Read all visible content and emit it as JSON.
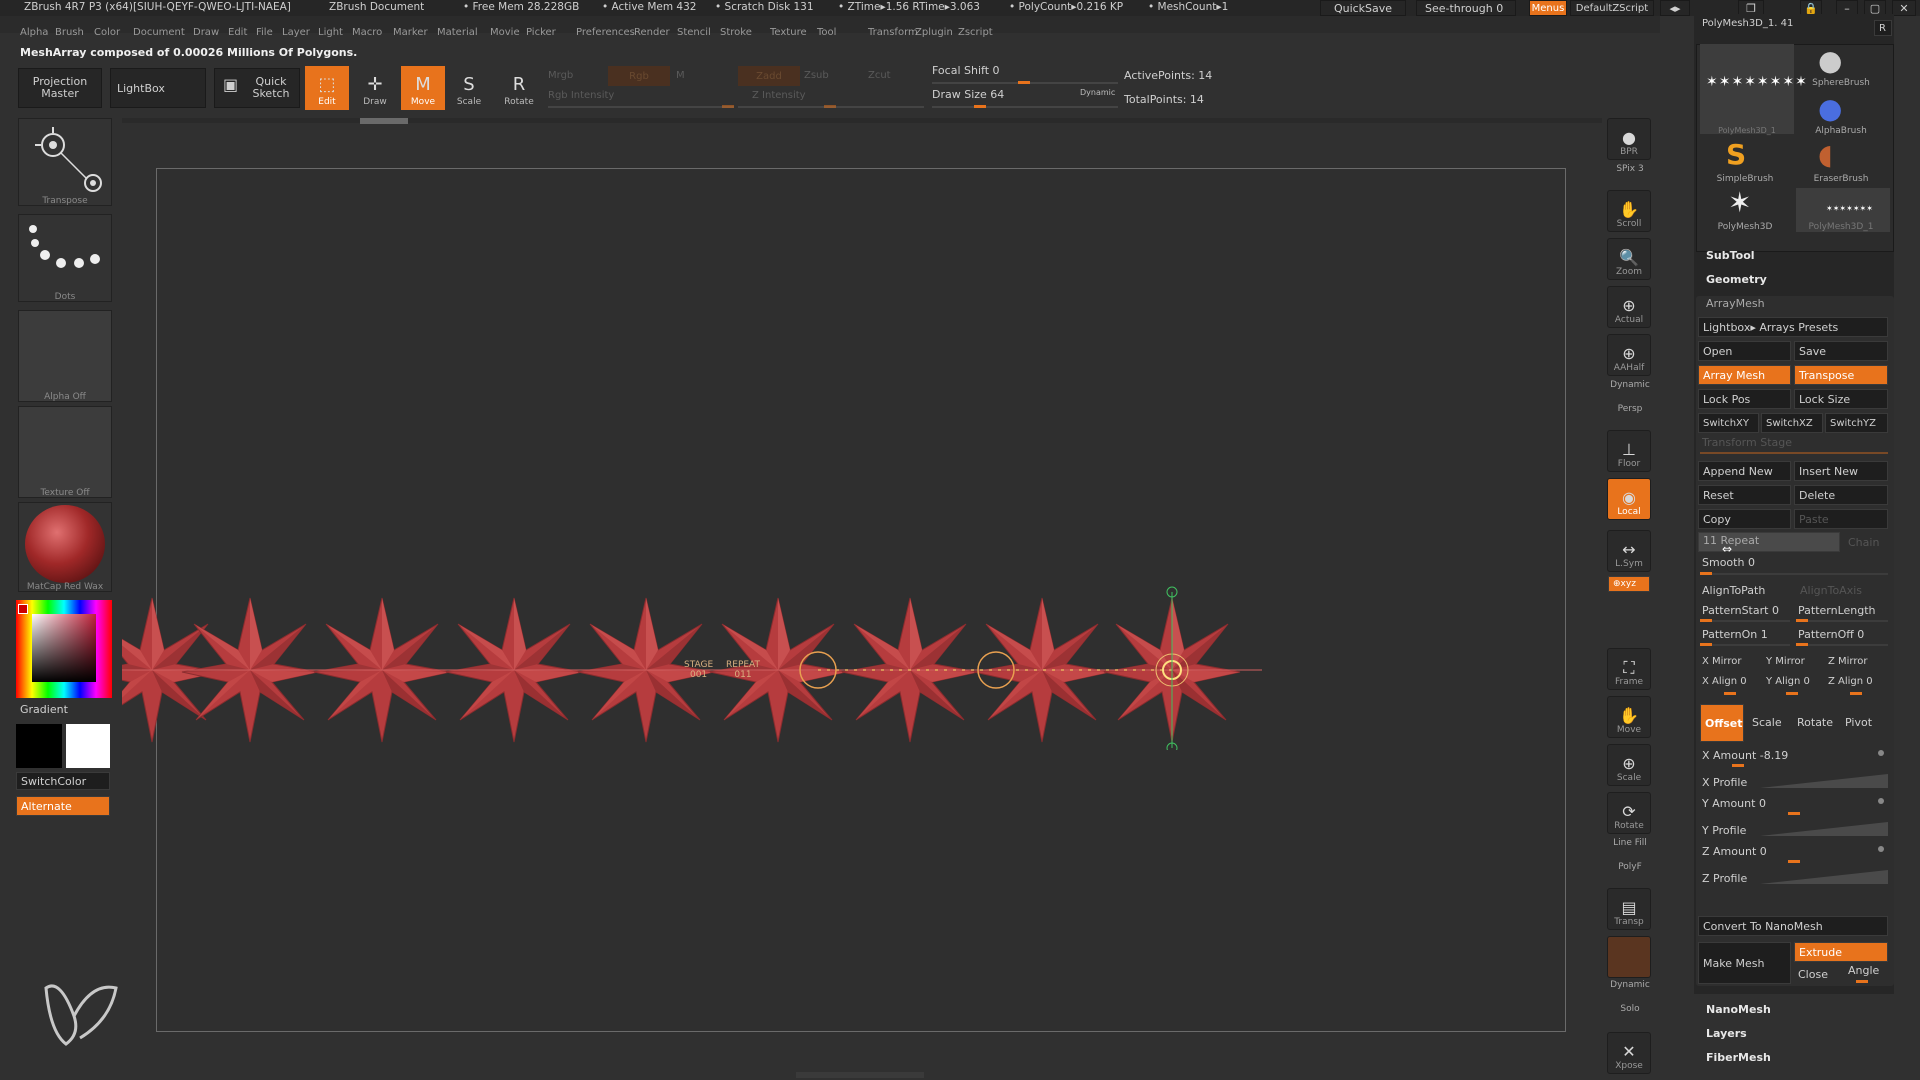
{
  "title_bar": {
    "app": "ZBrush 4R7 P3 (x64)[SIUH-QEYF-QWEO-LJTI-NAEA]",
    "document": "ZBrush Document",
    "free_mem": "• Free Mem 28.228GB",
    "active_mem": "• Active Mem 432",
    "scratch": "• Scratch Disk 131",
    "ztime": "• ZTime▸1.56 RTime▸3.063",
    "polycount": "• PolyCount▸0.216 KP",
    "meshcount": "• MeshCount▸1",
    "quicksave": "QuickSave",
    "seethrough": "See-through  0",
    "menus": "Menus",
    "script": "DefaultZScript"
  },
  "menu": [
    "Alpha",
    "Brush",
    "Color",
    "Document",
    "Draw",
    "Edit",
    "File",
    "Layer",
    "Light",
    "Macro",
    "Marker",
    "Material",
    "Movie",
    "Picker",
    "Preferences",
    "Render",
    "Stencil",
    "Stroke",
    "Texture",
    "Tool",
    "Transform",
    "Zplugin",
    "Zscript"
  ],
  "notification": "MeshArray composed of 0.00026 Millions Of Polygons.",
  "top_toolbar": {
    "projection_master": "Projection Master",
    "lightbox": "LightBox",
    "quick_sketch": "Quick Sketch",
    "edit": "Edit",
    "draw": "Draw",
    "move": "Move",
    "scale": "Scale",
    "rotate": "Rotate",
    "mrgb": "Mrgb",
    "rgb": "Rgb",
    "m": "M",
    "rgb_intensity": "Rgb Intensity",
    "zadd": "Zadd",
    "zsub": "Zsub",
    "zcut": "Zcut",
    "z_intensity": "Z Intensity",
    "focal_shift": "Focal Shift 0",
    "draw_size": "Draw Size 64",
    "dynamic": "Dynamic",
    "active_points": "ActivePoints: 14",
    "total_points": "TotalPoints: 14"
  },
  "left_shelf": {
    "transpose": "Transpose",
    "dots": "Dots",
    "alpha": "Alpha Off",
    "texture": "Texture Off",
    "material": "MatCap Red Wax",
    "gradient": "Gradient",
    "switch_color": "SwitchColor",
    "alternate": "Alternate"
  },
  "canvas_labels": {
    "stage": "STAGE",
    "stage_val": "001",
    "repeat": "REPEAT",
    "repeat_val": "011"
  },
  "right_dock": [
    {
      "label": "BPR"
    },
    {
      "label": "SPix 3"
    },
    {
      "label": "Scroll"
    },
    {
      "label": "Zoom"
    },
    {
      "label": "Actual"
    },
    {
      "label": "AAHalf"
    },
    {
      "label": "Dynamic"
    },
    {
      "label": "Persp"
    },
    {
      "label": "Floor"
    },
    {
      "label": "Local"
    },
    {
      "label": "L.Sym"
    },
    {
      "label": "Frame"
    },
    {
      "label": "Move"
    },
    {
      "label": "Scale"
    },
    {
      "label": "Rotate"
    },
    {
      "label": "Line Fill"
    },
    {
      "label": "PolyF"
    },
    {
      "label": "Transp"
    },
    {
      "label": "Dynamic"
    },
    {
      "label": "Solo"
    },
    {
      "label": "Xpose"
    }
  ],
  "tool_panel": {
    "current_tool": "PolyMesh3D_1. 41",
    "r": "R",
    "brushes": [
      "SphereBrush",
      "AlphaBrush",
      "SimpleBrush",
      "EraserBrush",
      "PolyMesh3D",
      "PolyMesh3D_1"
    ],
    "thumb_label": "PolyMesh3D_1",
    "subtool": "SubTool",
    "geometry": "Geometry",
    "arraymesh": "ArrayMesh",
    "lightbox_presets": "Lightbox▸ Arrays Presets",
    "open": "Open",
    "save": "Save",
    "array_mesh": "Array Mesh",
    "transpose": "Transpose",
    "lock_pos": "Lock Pos",
    "lock_size": "Lock Size",
    "switch_xy": "SwitchXY",
    "switch_xz": "SwitchXZ",
    "switch_yz": "SwitchYZ",
    "transform_stage": "Transform Stage",
    "append_new": "Append New",
    "insert_new": "Insert New",
    "reset": "Reset",
    "delete": "Delete",
    "copy": "Copy",
    "paste": "Paste",
    "repeat": "11 Repeat",
    "chain": "Chain",
    "smooth": "Smooth 0",
    "align_to_path": "AlignToPath",
    "align_to_axis": "AlignToAxis",
    "pattern_start": "PatternStart 0",
    "pattern_length": "PatternLength",
    "pattern_on": "PatternOn 1",
    "pattern_off": "PatternOff 0",
    "x_mirror": "X Mirror",
    "y_mirror": "Y Mirror",
    "z_mirror": "Z Mirror",
    "x_align": "X Align 0",
    "y_align": "Y Align 0",
    "z_align": "Z Align 0",
    "offset": "Offset",
    "scale": "Scale",
    "rotate": "Rotate",
    "pivot": "Pivot",
    "x_amount": "X Amount -8.19",
    "x_profile": "X Profile",
    "y_amount": "Y Amount 0",
    "y_profile": "Y Profile",
    "z_amount": "Z Amount 0",
    "z_profile": "Z Profile",
    "convert_nanomesh": "Convert To NanoMesh",
    "make_mesh": "Make Mesh",
    "extrude": "Extrude",
    "close": "Close",
    "angle": "Angle",
    "nanomesh": "NanoMesh",
    "layers": "Layers",
    "fibermesh": "FiberMesh"
  },
  "colors": {
    "accent": "#e8731c",
    "star": "#b83a3a",
    "background": "#303030"
  }
}
